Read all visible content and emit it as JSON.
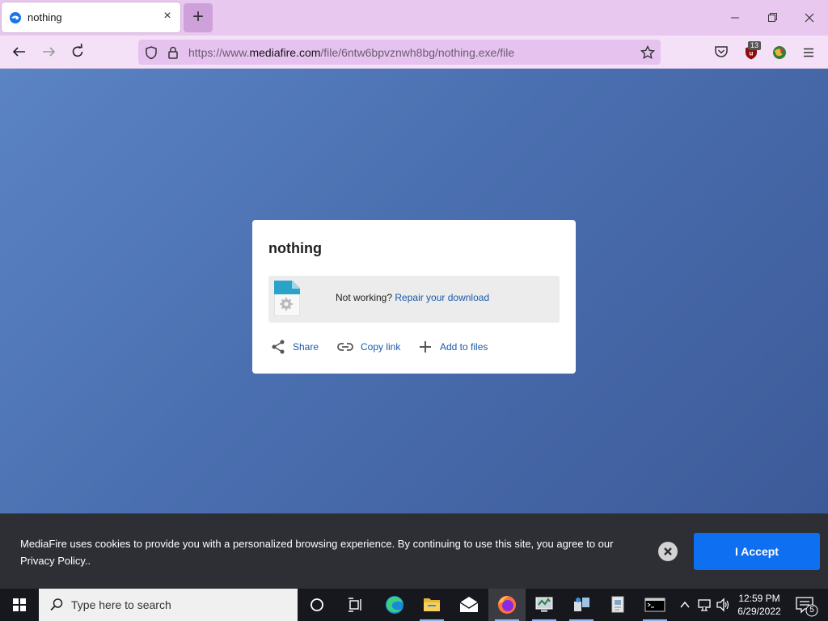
{
  "browser": {
    "tab_title": "nothing",
    "url_prefix": "https://www.",
    "url_domain": "mediafire.com",
    "url_path": "/file/6ntw6bpvznwh8bg/nothing.exe/file",
    "ublock_count": "13"
  },
  "card": {
    "file_name": "nothing",
    "not_working": "Not working?",
    "repair_link": "Repair your download",
    "share_label": "Share",
    "copy_link_label": "Copy link",
    "add_files_label": "Add to files"
  },
  "cookie": {
    "message": "MediaFire uses cookies to provide you with a personalized browsing experience. By continuing to use this site, you agree to our Privacy Policy..",
    "accept_label": "I Accept"
  },
  "taskbar": {
    "search_placeholder": "Type here to search",
    "time": "12:59 PM",
    "date": "6/29/2022",
    "notification_count": "5"
  },
  "colors": {
    "tabbar": "#e9c8f0",
    "accent": "#0e6ff0",
    "link": "#1a5aa8"
  }
}
